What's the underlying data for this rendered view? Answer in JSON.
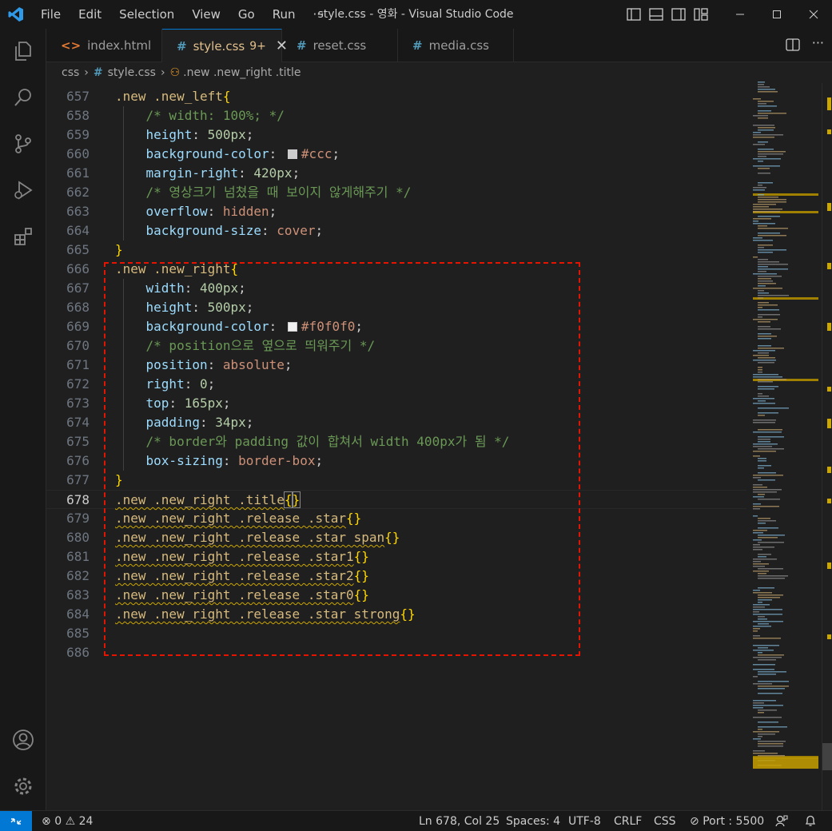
{
  "titlebar": {
    "menu": [
      "File",
      "Edit",
      "Selection",
      "View",
      "Go",
      "Run",
      "···"
    ],
    "title": "style.css - 영화 - Visual Studio Code"
  },
  "tabs": [
    {
      "label": "index.html",
      "icon": "html-file-icon"
    },
    {
      "label": "style.css",
      "badge": "9+",
      "icon": "css-file-icon",
      "active": true
    },
    {
      "label": "reset.css",
      "icon": "css-file-icon"
    },
    {
      "label": "media.css",
      "icon": "css-file-icon"
    }
  ],
  "breadcrumb": {
    "folder": "css",
    "file": "style.css",
    "symbol": ".new .new_right .title"
  },
  "editor": {
    "current_line": "678",
    "lines": [
      {
        "n": "657"
      },
      {
        "n": "658"
      },
      {
        "n": "659"
      },
      {
        "n": "660"
      },
      {
        "n": "661"
      },
      {
        "n": "662"
      },
      {
        "n": "663"
      },
      {
        "n": "664"
      },
      {
        "n": "665"
      },
      {
        "n": "666"
      },
      {
        "n": "667"
      },
      {
        "n": "668"
      },
      {
        "n": "669"
      },
      {
        "n": "670"
      },
      {
        "n": "671"
      },
      {
        "n": "672"
      },
      {
        "n": "673"
      },
      {
        "n": "674"
      },
      {
        "n": "675"
      },
      {
        "n": "676"
      },
      {
        "n": "677"
      },
      {
        "n": "678"
      },
      {
        "n": "679"
      },
      {
        "n": "680"
      },
      {
        "n": "681"
      },
      {
        "n": "682"
      },
      {
        "n": "683"
      },
      {
        "n": "684"
      },
      {
        "n": "685"
      },
      {
        "n": "686"
      }
    ],
    "text": {
      "l657_sel": ".new .new_left",
      "l658_cmt": "/* width: 100%; */",
      "l659_prop": "height",
      "l659_num": "500px",
      "l660_prop": "background-color",
      "l660_val": "#ccc",
      "l661_prop": "margin-right",
      "l661_num": "420px",
      "l662_cmt": "/* 영상크기 넘쳤을 때 보이지 않게해주기 */",
      "l663_prop": "overflow",
      "l663_val": "hidden",
      "l664_prop": "background-size",
      "l664_val": "cover",
      "l666_sel": ".new .new_right",
      "l667_prop": "width",
      "l667_num": "400px",
      "l668_prop": "height",
      "l668_num": "500px",
      "l669_prop": "background-color",
      "l669_val": "#f0f0f0",
      "l670_cmt": "/* position으로 옆으로 띄워주기 */",
      "l671_prop": "position",
      "l671_val": "absolute",
      "l672_prop": "right",
      "l672_num": "0",
      "l673_prop": "top",
      "l673_num": "165px",
      "l674_prop": "padding",
      "l674_num": "34px",
      "l675_cmt": "/* border와 padding 값이 합쳐서 width 400px가 됨 */",
      "l676_prop": "box-sizing",
      "l676_val": "border-box",
      "l678_sel": ".new .new_right .title",
      "l679_sel": ".new .new_right .release .star",
      "l680_sel": ".new .new_right .release .star span",
      "l681_sel": ".new .new_right .release .star1",
      "l682_sel": ".new .new_right .release .star2",
      "l683_sel": ".new .new_right .release .star0",
      "l684_sel": ".new .new_right .release .star strong"
    },
    "swatch_colors": {
      "l660": "#cccccc",
      "l669": "#f0f0f0"
    }
  },
  "statusbar": {
    "errors": "0",
    "warnings": "24",
    "position": "Ln 678, Col 25",
    "spaces": "Spaces: 4",
    "encoding": "UTF-8",
    "eol": "CRLF",
    "language": "CSS",
    "port": "Port : 5500"
  },
  "colors": {
    "accent": "#0078d4",
    "annotation_box": "#e51400",
    "selector": "#d7ba7d",
    "property": "#9cdcfe",
    "value": "#ce9178",
    "number": "#b5cea8",
    "comment": "#6a9955",
    "warning_squiggle": "#cca700"
  }
}
